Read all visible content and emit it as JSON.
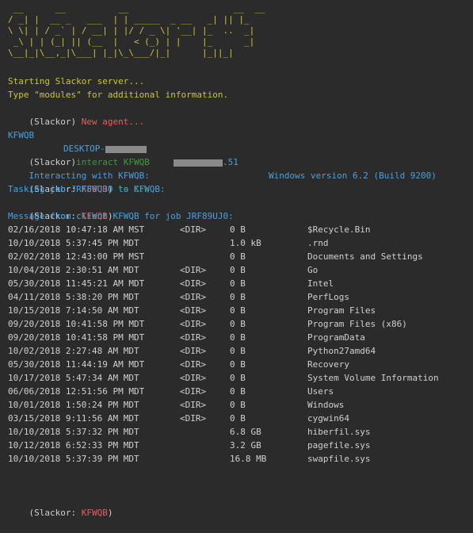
{
  "banner": [
    " __      __          __                    __  __",
    "/ _| |  __ _   ___  | | _____  _ __   _| || |_",
    "\\ \\| | / _` | / __| | |/ / _ \\| '__| |_  ..  _|",
    " _\\ | | (_| || (__  |   < (_) | |    |_      _|",
    "\\__|_|\\__,_|\\___| |_|\\_\\___/|_|      |_||_|"
  ],
  "server": {
    "starting": "Starting Slackor server...",
    "modules_hint": "Type \"modules\" for additional information."
  },
  "prompt_plain": "(Slackor)",
  "new_agent": "New agent...",
  "agent": {
    "id": "KFWQB",
    "host_prefix": "DESKTOP-",
    "ip_suffix": ".51",
    "os": "Windows version 6.2 (Build 9200)"
  },
  "interact_cmd": "interact KFWQB",
  "interacting_prefix": "Interacting with",
  "interacting_agent": "KFWQB:",
  "prompt_agent_prefix": "(Slackor: ",
  "prompt_agent_suffix": ")",
  "ls_cmd": "ls C:\\",
  "tasking": "Tasking job JRF89UJ0 to KFWQB:",
  "message": "Message from client KFWQB for job JRF89UJ0:",
  "listing": [
    {
      "date": "02/16/2018 10:47:18 AM MST",
      "dir": "<DIR>",
      "size": "0 B",
      "name": "$Recycle.Bin"
    },
    {
      "date": "10/10/2018 5:37:45 PM MDT",
      "dir": "",
      "size": "1.0 kB",
      "name": ".rnd"
    },
    {
      "date": "02/02/2018 12:43:00 PM MST",
      "dir": "",
      "size": "0 B",
      "name": "Documents and Settings"
    },
    {
      "date": "10/04/2018 2:30:51 AM MDT",
      "dir": "<DIR>",
      "size": "0 B",
      "name": "Go"
    },
    {
      "date": "05/30/2018 11:45:21 AM MDT",
      "dir": "<DIR>",
      "size": "0 B",
      "name": "Intel"
    },
    {
      "date": "04/11/2018 5:38:20 PM MDT",
      "dir": "<DIR>",
      "size": "0 B",
      "name": "PerfLogs"
    },
    {
      "date": "10/15/2018 7:14:50 AM MDT",
      "dir": "<DIR>",
      "size": "0 B",
      "name": "Program Files"
    },
    {
      "date": "09/20/2018 10:41:58 PM MDT",
      "dir": "<DIR>",
      "size": "0 B",
      "name": "Program Files (x86)"
    },
    {
      "date": "09/20/2018 10:41:58 PM MDT",
      "dir": "<DIR>",
      "size": "0 B",
      "name": "ProgramData"
    },
    {
      "date": "10/02/2018 2:27:48 AM MDT",
      "dir": "<DIR>",
      "size": "0 B",
      "name": "Python27amd64"
    },
    {
      "date": "05/30/2018 11:44:19 AM MDT",
      "dir": "<DIR>",
      "size": "0 B",
      "name": "Recovery"
    },
    {
      "date": "10/17/2018 5:47:34 AM MDT",
      "dir": "<DIR>",
      "size": "0 B",
      "name": "System Volume Information"
    },
    {
      "date": "06/06/2018 12:51:56 PM MDT",
      "dir": "<DIR>",
      "size": "0 B",
      "name": "Users"
    },
    {
      "date": "10/01/2018 1:50:24 PM MDT",
      "dir": "<DIR>",
      "size": "0 B",
      "name": "Windows"
    },
    {
      "date": "03/15/2018 9:11:56 AM MDT",
      "dir": "<DIR>",
      "size": "0 B",
      "name": "cygwin64"
    },
    {
      "date": "10/10/2018 5:37:32 PM MDT",
      "dir": "",
      "size": "6.8 GB",
      "name": "hiberfil.sys"
    },
    {
      "date": "10/12/2018 6:52:33 PM MDT",
      "dir": "",
      "size": "3.2 GB",
      "name": "pagefile.sys"
    },
    {
      "date": "10/10/2018 5:37:39 PM MDT",
      "dir": "",
      "size": "16.8 MB",
      "name": "swapfile.sys"
    }
  ],
  "colors": {
    "background": "#2b2b2b",
    "banner": "#c9c637",
    "agent_red": "#e0605c",
    "command_green": "#3e9a3e",
    "info_blue": "#4aa0e0"
  }
}
